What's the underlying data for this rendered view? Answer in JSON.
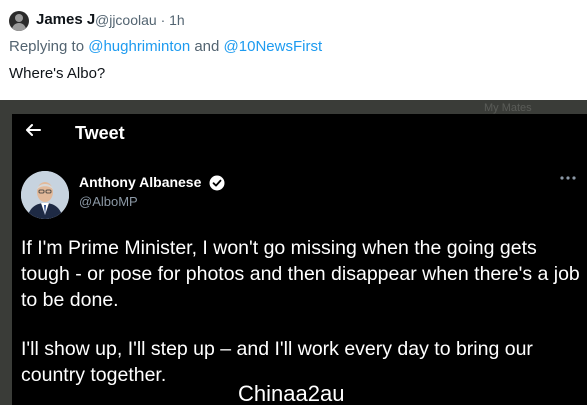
{
  "reply_tweet": {
    "display_name": "James J",
    "meta": "@jjcoolau · 1h",
    "replying_prefix": "Replying to ",
    "replying_handle_1": "@hughriminton",
    "replying_and": " and ",
    "replying_handle_2": "@10NewsFirst",
    "text": "Where's Albo?"
  },
  "screenshot": {
    "background_label": "My Mates",
    "header_title": "Tweet",
    "author": {
      "name": "Anthony Albanese",
      "handle": "@AlboMP"
    },
    "paragraphs": [
      "If I'm Prime Minister, I won't go missing when the going gets tough - or pose for photos and then disappear when there's a job to be done.",
      "I'll show up, I'll step up – and I'll work every day to bring our country together."
    ]
  },
  "watermark": "Chinaa2au",
  "colors": {
    "link": "#1d9bf0",
    "dark_bg": "#000000",
    "muted": "#536471"
  },
  "icons": [
    "back-arrow-icon",
    "verified-badge-icon",
    "more-options-icon"
  ]
}
